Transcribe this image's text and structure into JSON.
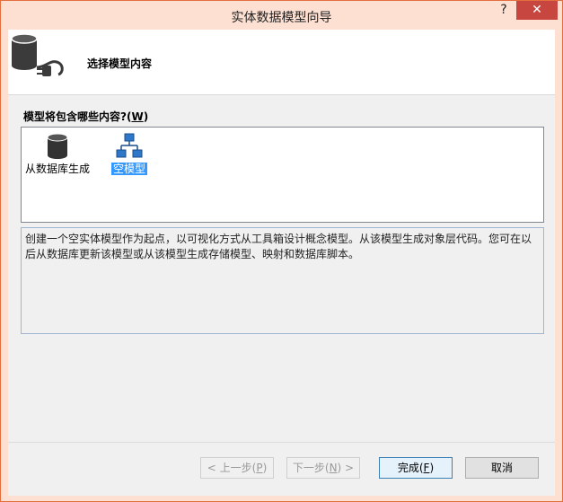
{
  "window": {
    "title": "实体数据模型向导",
    "help_glyph": "?",
    "close_glyph": "✕"
  },
  "header": {
    "title": "选择模型内容",
    "icon": "database-plug-icon"
  },
  "prompt": {
    "label": "模型将包含哪些内容?(",
    "accesskey": "W",
    "label_end": ")"
  },
  "model_options": {
    "items": [
      {
        "label": "从数据库生成",
        "icon": "database-icon",
        "selected": false
      },
      {
        "label": "空模型",
        "icon": "empty-model-icon",
        "selected": true
      }
    ]
  },
  "description": "创建一个空实体模型作为起点，以可视化方式从工具箱设计概念模型。从该模型生成对象层代码。您可在以后从数据库更新该模型或从该模型生成存储模型、映射和数据库脚本。",
  "buttons": {
    "prev": {
      "label_pre": "< 上一步(",
      "key": "P",
      "label_post": ")",
      "enabled": false
    },
    "next": {
      "label_pre": "下一步(",
      "key": "N",
      "label_post": ") >",
      "enabled": false
    },
    "finish": {
      "label_pre": "完成(",
      "key": "F",
      "label_post": ")",
      "enabled": true
    },
    "cancel": {
      "label": "取消",
      "enabled": true
    }
  },
  "colors": {
    "titlebar": "#fde0d1",
    "close": "#c7463f",
    "selection": "#3399ff",
    "accent_border": "#3c7fb1"
  }
}
